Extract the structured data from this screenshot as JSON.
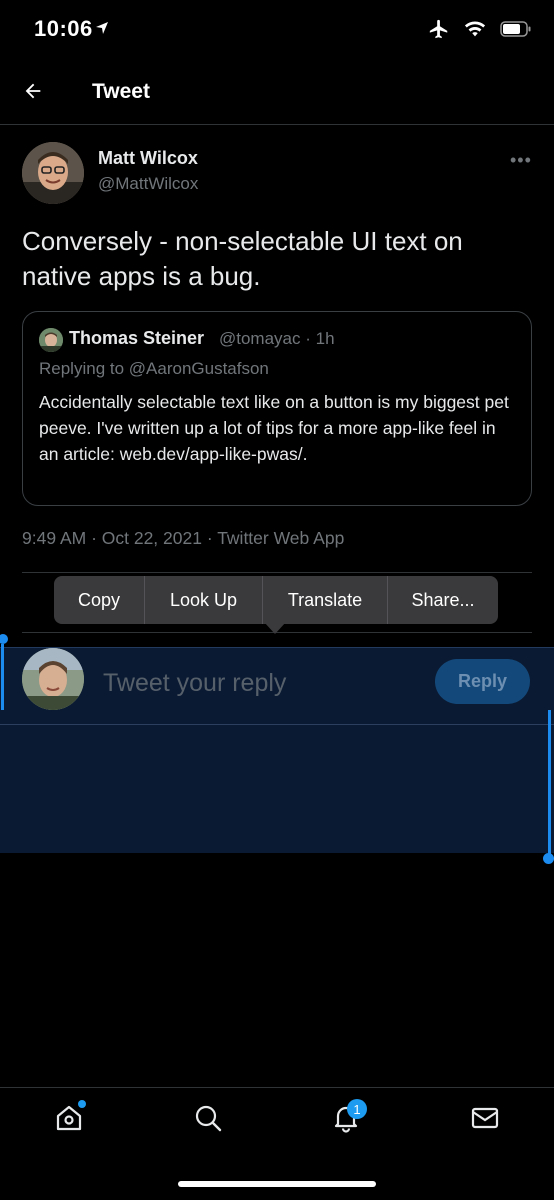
{
  "status_bar": {
    "time": "10:06",
    "icons": [
      "location-arrow-icon",
      "airplane-icon",
      "wifi-icon",
      "battery-icon"
    ]
  },
  "header": {
    "title": "Tweet",
    "back_icon": "arrow-left-icon"
  },
  "tweet": {
    "author_name": "Matt Wilcox",
    "author_handle": "@MattWilcox",
    "more_label": "•••",
    "text": "Conversely - non-selectable UI text on native apps is a bug.",
    "timestamp": "9:49 AM · Oct 22, 2021 · Twitter Web App"
  },
  "quoted_tweet": {
    "author_name": "Thomas Steiner",
    "author_handle": "@tomayac · 1h",
    "replying_to": "Replying to @AaronGustafson",
    "text": "Accidentally selectable text like on a button is my biggest pet peeve. I've written up a lot of tips for a more app-like feel in an article: web.dev/app-like-pwas/."
  },
  "context_menu": {
    "items": [
      "Copy",
      "Look Up",
      "Translate",
      "Share..."
    ]
  },
  "reply": {
    "placeholder": "Tweet your reply",
    "button_label": "Reply"
  },
  "tab_bar": {
    "items": [
      "home-icon",
      "search-icon",
      "notifications-icon",
      "messages-icon"
    ],
    "notification_count": "1"
  },
  "colors": {
    "accent": "#1d9bf0",
    "background": "#000000",
    "muted_text": "#71767b",
    "selection": "#0b1a33"
  }
}
